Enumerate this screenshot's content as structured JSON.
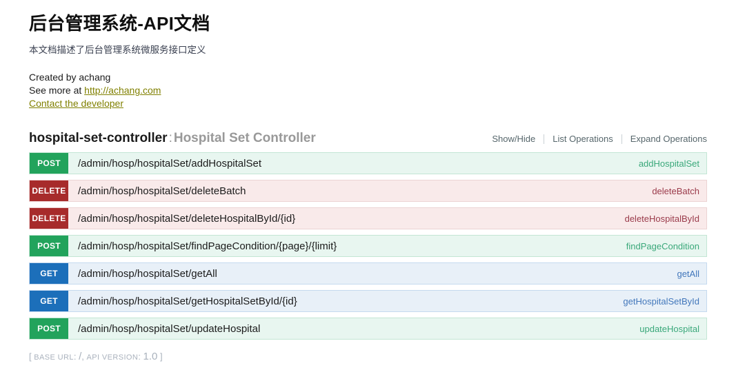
{
  "header": {
    "title": "后台管理系统-API文档",
    "subtitle": "本文档描述了后台管理系统微服务接口定义",
    "created_by": "Created by achang",
    "see_more_prefix": "See more at ",
    "see_more_link": "http://achang.com",
    "contact_link": "Contact the developer"
  },
  "controller": {
    "name": "hospital-set-controller",
    "separator": ":",
    "description": "Hospital Set Controller",
    "links": {
      "show_hide": "Show/Hide",
      "list_operations": "List Operations",
      "expand_operations": "Expand Operations"
    }
  },
  "operations": [
    {
      "method": "POST",
      "path": "/admin/hosp/hospitalSet/addHospitalSet",
      "summary": "addHospitalSet"
    },
    {
      "method": "DELETE",
      "path": "/admin/hosp/hospitalSet/deleteBatch",
      "summary": "deleteBatch"
    },
    {
      "method": "DELETE",
      "path": "/admin/hosp/hospitalSet/deleteHospitalById/{id}",
      "summary": "deleteHospitalById"
    },
    {
      "method": "POST",
      "path": "/admin/hosp/hospitalSet/findPageCondition/{page}/{limit}",
      "summary": "findPageCondition"
    },
    {
      "method": "GET",
      "path": "/admin/hosp/hospitalSet/getAll",
      "summary": "getAll"
    },
    {
      "method": "GET",
      "path": "/admin/hosp/hospitalSet/getHospitalSetById/{id}",
      "summary": "getHospitalSetById"
    },
    {
      "method": "POST",
      "path": "/admin/hosp/hospitalSet/updateHospital",
      "summary": "updateHospital"
    }
  ],
  "footer": {
    "open_bracket": "[",
    "base_url_label": "BASE URL",
    "base_url_value": "/",
    "comma": ",",
    "api_version_label": "API VERSION",
    "api_version_value": "1.0",
    "close_bracket": "]"
  },
  "colors": {
    "post": "#22a35c",
    "get": "#1c6fba",
    "delete": "#a72b2b",
    "link": "#808000"
  }
}
